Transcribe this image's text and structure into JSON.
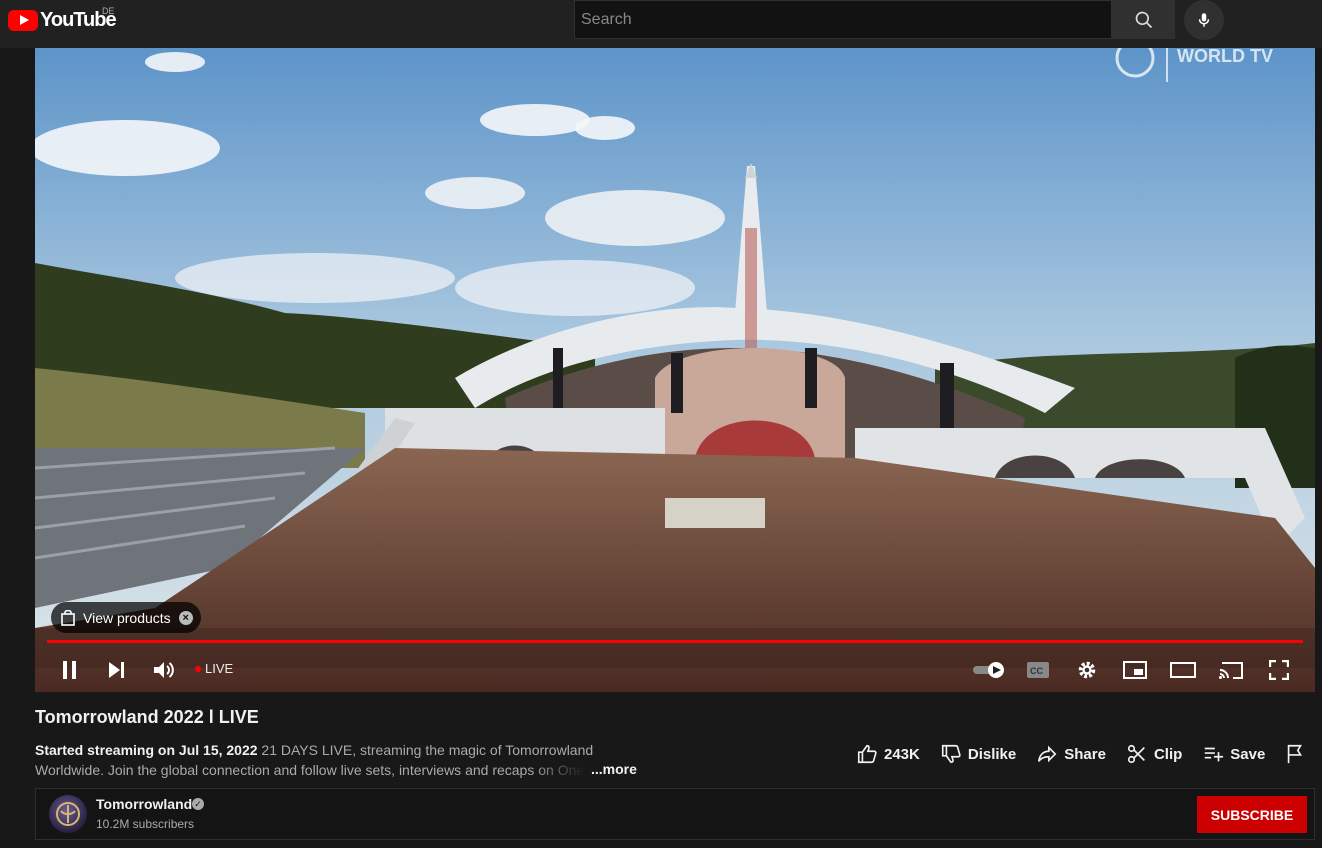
{
  "header": {
    "logo_text": "YouTube",
    "country_code": "DE",
    "search_placeholder": "Search"
  },
  "player": {
    "view_products_label": "View products",
    "live_label": "LIVE",
    "watermark_text": "WORLD TV",
    "progress_fraction": 1.0,
    "progress_color": "#ff0000"
  },
  "video": {
    "title": "Tomorrowland 2022 l LIVE",
    "started": "Started streaming on Jul 15, 2022",
    "description_line1": "21 DAYS LIVE, streaming the magic of Tomorrowland",
    "description_line2": "Worldwide. Join the global connection and follow live sets, interviews and recaps on One",
    "more_label": "...more"
  },
  "actions": {
    "likes": "243K",
    "dislike_label": "Dislike",
    "share_label": "Share",
    "clip_label": "Clip",
    "save_label": "Save"
  },
  "channel": {
    "name": "Tomorrowland",
    "subscribers": "10.2M subscribers",
    "subscribe_label": "SUBSCRIBE",
    "subscribe_color": "#cc0000"
  },
  "icons": [
    "youtube-logo-icon",
    "search-icon",
    "mic-icon",
    "bag-icon",
    "close-icon",
    "pause-icon",
    "next-icon",
    "volume-icon",
    "autoplay-toggle-icon",
    "cc-icon",
    "settings-icon",
    "miniplayer-icon",
    "theater-icon",
    "cast-icon",
    "fullscreen-icon",
    "like-icon",
    "dislike-icon",
    "share-icon",
    "clip-icon",
    "save-icon",
    "flag-icon",
    "verified-icon"
  ]
}
